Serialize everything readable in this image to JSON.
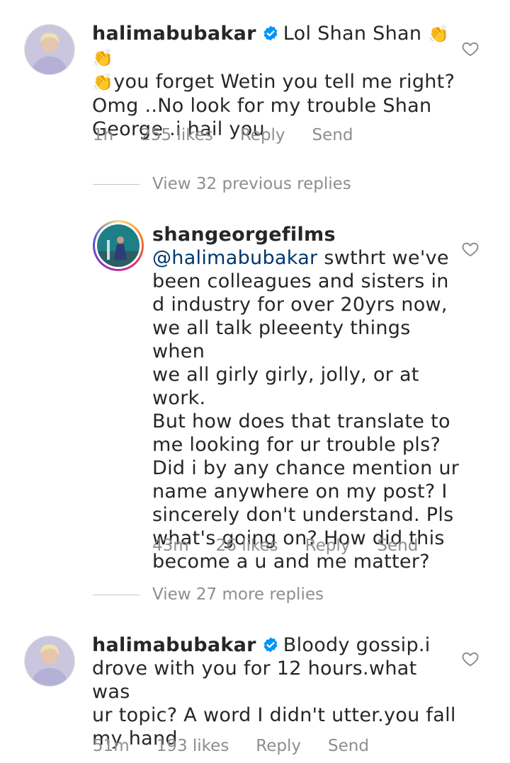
{
  "comments": [
    {
      "username": "halimabubakar",
      "verified": true,
      "lines": [
        {
          "prefix": "",
          "text": "Lol Shan Shan",
          "emoji": "👏👏"
        },
        {
          "prefix": "👏",
          "text": "you forget Wetin you tell me right?"
        },
        {
          "text": "Omg ..No look for my trouble Shan"
        },
        {
          "text": "George .i hail you"
        }
      ],
      "meta": {
        "time": "1h",
        "likes": "255 likes",
        "reply": "Reply",
        "send": "Send"
      }
    },
    {
      "username": "shangeorgefilms",
      "mention": "@halimabubakar",
      "first_line_rest": " swthrt we've",
      "lines": [
        "been colleagues and sisters in",
        "d industry for over 20yrs now,",
        "we all talk pleeenty things when",
        "we all girly girly, jolly, or at work.",
        "But how does that translate to",
        "me looking for ur trouble pls?",
        "Did i by any chance mention ur",
        "name anywhere on my post? I",
        "sincerely don't understand. Pls",
        "what's going on? How did this",
        "become a u and me matter?"
      ],
      "meta": {
        "time": "43m",
        "likes": "26 likes",
        "reply": "Reply",
        "send": "Send"
      }
    },
    {
      "username": "halimabubakar",
      "verified": true,
      "first_line_rest": "Bloody gossip.i",
      "lines": [
        "drove with you for 12 hours.what was",
        "ur topic? A word I didn't utter.you fall",
        "my hand"
      ],
      "meta": {
        "time": "51m",
        "likes": "193 likes",
        "reply": "Reply",
        "send": "Send"
      }
    }
  ],
  "view_previous": "View 32 previous replies",
  "view_more": "View 27 more replies",
  "colors": {
    "text": "#262626",
    "secondary": "#8e8e8e",
    "mention": "#00376b",
    "verified": "#0095f6"
  },
  "icons": [
    "verified-badge-icon",
    "heart-outline-icon",
    "clapping-hands-emoji"
  ]
}
